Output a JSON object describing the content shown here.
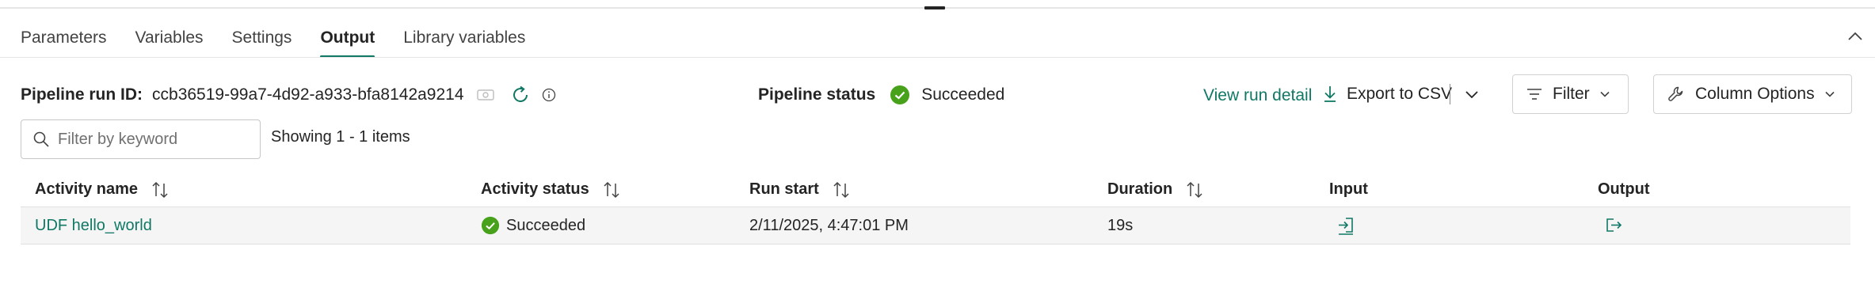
{
  "tabs": [
    {
      "label": "Parameters"
    },
    {
      "label": "Variables"
    },
    {
      "label": "Settings"
    },
    {
      "label": "Output"
    },
    {
      "label": "Library variables"
    }
  ],
  "active_tab": "Output",
  "run": {
    "id_label": "Pipeline run ID:",
    "id_value": "ccb36519-99a7-4d92-a933-bfa8142a9214"
  },
  "pipeline_status": {
    "label": "Pipeline status",
    "value": "Succeeded"
  },
  "actions": {
    "view_run_detail": "View run detail",
    "export_csv": "Export to CSV",
    "filter": "Filter",
    "column_options": "Column Options"
  },
  "search": {
    "placeholder": "Filter by keyword",
    "value": ""
  },
  "showing_text": "Showing 1 - 1 items",
  "table": {
    "columns": [
      "Activity name",
      "Activity status",
      "Run start",
      "Duration",
      "Input",
      "Output"
    ],
    "rows": [
      {
        "activity_name": "UDF hello_world",
        "activity_status": "Succeeded",
        "run_start": "2/11/2025, 4:47:01 PM",
        "duration": "19s"
      }
    ]
  },
  "colors": {
    "accent": "#117865",
    "success": "#47A11A",
    "text": "#242424"
  },
  "icons": {
    "copy": "copy-icon",
    "refresh": "refresh-icon",
    "info": "info-icon",
    "success": "checkmark-circle-icon",
    "download": "download-icon",
    "filter": "filter-icon",
    "wrench": "wrench-icon",
    "search": "search-icon",
    "sort": "sort-icon",
    "input": "input-icon",
    "output": "output-icon",
    "chevron_up": "chevron-up-icon",
    "chevron_down": "chevron-down-icon"
  }
}
